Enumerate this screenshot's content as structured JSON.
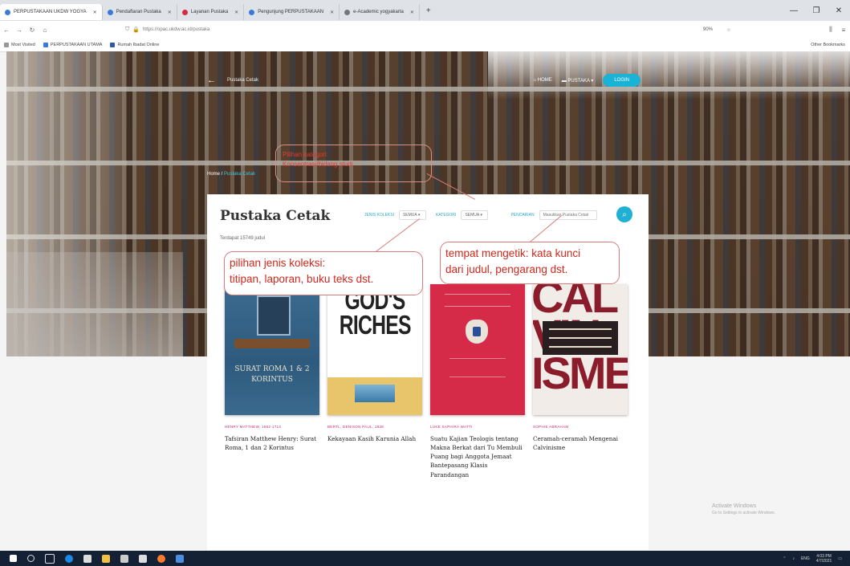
{
  "browser": {
    "tabs": [
      {
        "label": "PERPUSTAKAAN UKDW YOGYA",
        "color": "#3b7bd8",
        "active": true
      },
      {
        "label": "Pendaftaran Pustaka",
        "color": "#3b7bd8",
        "active": false
      },
      {
        "label": "Layanan Pustaka",
        "color": "#d62b48",
        "active": false
      },
      {
        "label": "Pengunjung PERPUSTAKAAN",
        "color": "#3b7bd8",
        "active": false
      },
      {
        "label": "e-Academic yogyakarta",
        "color": "#777777",
        "active": false
      }
    ],
    "new_tab": "+",
    "url": "https://opac.ukdw.ac.id/pustaka",
    "zoom": "90%",
    "bookmarks": [
      "Most Visited",
      "PERPUSTAKAAN UTAMA",
      "Rumah Ibadat Online"
    ],
    "other_bookmarks": "Other Bookmarks"
  },
  "site": {
    "nav_title": "Pustaka Cetak",
    "nav_home": "HOME",
    "nav_pustaka": "PUSTAKA",
    "login": "LOGIN",
    "breadcrumb_home": "Home",
    "breadcrumb_current": "Pustaka Cetak"
  },
  "page": {
    "title": "Pustaka Cetak",
    "count_text": "Terdapat 15749 judul",
    "filters": [
      {
        "label": "JENIS KOLEKSI",
        "value": "SEMUA"
      },
      {
        "label": "KATEGORI",
        "value": "SEMUA"
      }
    ],
    "search_label": "PENCARIAN",
    "search_placeholder": "Masukkan Pustaka Cetak"
  },
  "books": [
    {
      "author": "HENRY MATTHEW, 1662-1714",
      "title": "Tafsiran Matthew Henry: Surat Roma, 1 dan 2 Korintus",
      "cover_text": "SURAT ROMA 1 & 2 KORINTUS"
    },
    {
      "author": "BERTL, DENISON PAUL, 1938",
      "title": "Kekayaan Kasih Karunia Allah",
      "cover_text": "GOD'S RICHES"
    },
    {
      "author": "LUKE SAPHIRA WATTI",
      "title": "Suatu Kajian Teologis tentang Makna Berkat dari Tu Membuli Puang bagi Anggota Jemaat Bantepasang Klasis Parandangan",
      "cover_text": ""
    },
    {
      "author": "SOPHIE ABRAHAM",
      "title": "Ceramah-ceramah Mengenai Calvinisme",
      "cover_text": "CAL VIN ISME"
    }
  ],
  "annotations": {
    "top": [
      "Pilihan kategori:",
      "Konsentrasi/bidang studi"
    ],
    "left": [
      "pilihan jenis koleksi:",
      "titipan, laporan, buku teks dst."
    ],
    "right": [
      "tempat mengetik: kata kunci",
      "dari judul, pengarang dst."
    ]
  },
  "windows": {
    "activate_title": "Activate Windows",
    "activate_sub": "Go to Settings to activate Windows.",
    "time": "4:03 PM",
    "date": "4/7/2021",
    "lang": "ENG"
  },
  "colors": {
    "accent": "#1fb0d3",
    "author": "#c62870",
    "annotation": "#d1281c"
  }
}
